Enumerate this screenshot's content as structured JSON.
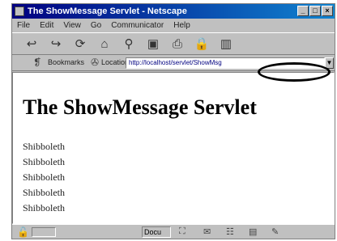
{
  "window": {
    "title": "The ShowMessage Servlet - Netscape"
  },
  "menu": {
    "items": [
      "File",
      "Edit",
      "View",
      "Go",
      "Communicator",
      "Help"
    ]
  },
  "toolbar": {
    "icons": [
      "back-icon",
      "forward-icon",
      "reload-icon",
      "home-icon",
      "search-icon",
      "netscape-icon",
      "print-icon",
      "security-icon",
      "stop-icon"
    ]
  },
  "location_bar": {
    "bookmarks_label": "Bookmarks",
    "location_label": "Location:",
    "url": "http://localhost/servlet/ShowMsg"
  },
  "page": {
    "heading": "The ShowMessage Servlet",
    "lines": [
      "Shibboleth",
      "Shibboleth",
      "Shibboleth",
      "Shibboleth",
      "Shibboleth"
    ]
  },
  "status_bar": {
    "status_text": "Docu"
  }
}
